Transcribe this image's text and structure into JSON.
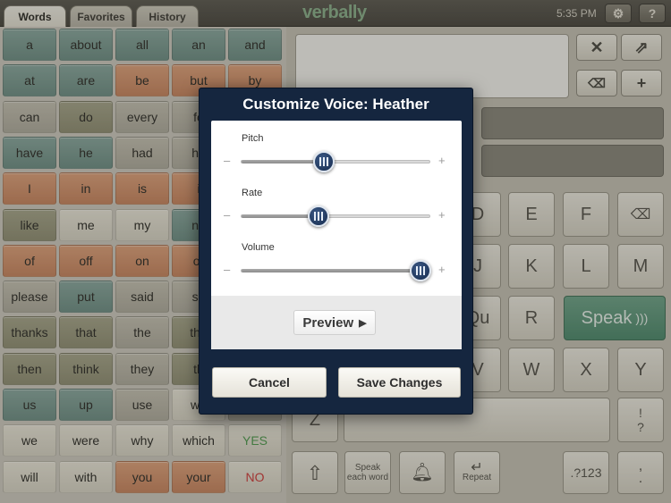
{
  "tabs": [
    {
      "label": "Words",
      "active": true
    },
    {
      "label": "Favorites",
      "active": false
    },
    {
      "label": "History",
      "active": false
    }
  ],
  "app_logo": "verbally",
  "clock": "5:35 PM",
  "topbar_buttons": {
    "settings_icon": "gear-icon",
    "help_label": "?"
  },
  "words": [
    {
      "label": "a",
      "color": "teal"
    },
    {
      "label": "about",
      "color": "teal"
    },
    {
      "label": "all",
      "color": "teal"
    },
    {
      "label": "an",
      "color": "teal"
    },
    {
      "label": "and",
      "color": "teal"
    },
    {
      "label": "at",
      "color": "teal"
    },
    {
      "label": "are",
      "color": "teal"
    },
    {
      "label": "be",
      "color": "orange"
    },
    {
      "label": "but",
      "color": "orange"
    },
    {
      "label": "by",
      "color": "orange"
    },
    {
      "label": "can",
      "color": "gray"
    },
    {
      "label": "do",
      "color": "olive"
    },
    {
      "label": "every",
      "color": "gray"
    },
    {
      "label": "fo",
      "color": "gray"
    },
    {
      "label": "",
      "color": "gray"
    },
    {
      "label": "have",
      "color": "teal"
    },
    {
      "label": "he",
      "color": "teal"
    },
    {
      "label": "had",
      "color": "gray"
    },
    {
      "label": "he",
      "color": "gray"
    },
    {
      "label": "",
      "color": "gray"
    },
    {
      "label": "I",
      "color": "orange"
    },
    {
      "label": "in",
      "color": "orange"
    },
    {
      "label": "is",
      "color": "orange"
    },
    {
      "label": "i",
      "color": "orange"
    },
    {
      "label": "",
      "color": "gray"
    },
    {
      "label": "like",
      "color": "olive"
    },
    {
      "label": "me",
      "color": "cream"
    },
    {
      "label": "my",
      "color": "cream"
    },
    {
      "label": "ne",
      "color": "teal"
    },
    {
      "label": "",
      "color": "gray"
    },
    {
      "label": "of",
      "color": "orange"
    },
    {
      "label": "off",
      "color": "orange"
    },
    {
      "label": "on",
      "color": "orange"
    },
    {
      "label": "or",
      "color": "orange"
    },
    {
      "label": "",
      "color": "gray"
    },
    {
      "label": "please",
      "color": "gray"
    },
    {
      "label": "put",
      "color": "teal"
    },
    {
      "label": "said",
      "color": "gray"
    },
    {
      "label": "sh",
      "color": "gray"
    },
    {
      "label": "",
      "color": "gray"
    },
    {
      "label": "thanks",
      "color": "olive"
    },
    {
      "label": "that",
      "color": "olive"
    },
    {
      "label": "the",
      "color": "gray"
    },
    {
      "label": "the",
      "color": "olive"
    },
    {
      "label": "",
      "color": "gray"
    },
    {
      "label": "then",
      "color": "olive"
    },
    {
      "label": "think",
      "color": "olive"
    },
    {
      "label": "they",
      "color": "gray"
    },
    {
      "label": "th",
      "color": "olive"
    },
    {
      "label": "",
      "color": "gray"
    },
    {
      "label": "us",
      "color": "teal"
    },
    {
      "label": "up",
      "color": "teal"
    },
    {
      "label": "use",
      "color": "gray"
    },
    {
      "label": "wa",
      "color": "cream"
    },
    {
      "label": "",
      "color": "gray"
    },
    {
      "label": "we",
      "color": "cream"
    },
    {
      "label": "were",
      "color": "cream"
    },
    {
      "label": "why",
      "color": "cream"
    },
    {
      "label": "which",
      "color": "cream"
    },
    {
      "label": "YES",
      "color": "yes"
    },
    {
      "label": "will",
      "color": "cream"
    },
    {
      "label": "with",
      "color": "cream"
    },
    {
      "label": "you",
      "color": "orange"
    },
    {
      "label": "your",
      "color": "orange"
    },
    {
      "label": "NO",
      "color": "no"
    }
  ],
  "side_buttons": {
    "clear_icon": "close-icon",
    "share_icon": "share-icon",
    "backspace_icon": "backspace-icon",
    "add_label": "+"
  },
  "keyboard": {
    "row1": [
      "D",
      "E",
      "F"
    ],
    "backspace_icon": "backspace-icon",
    "row2": [
      "J",
      "K",
      "L",
      "M"
    ],
    "row3": [
      "Qu",
      "R"
    ],
    "speak_label": "Speak",
    "row4": [
      "V",
      "W",
      "X",
      "Y"
    ],
    "z_key": "Z",
    "punct_top": "!\n?",
    "shift_icon": "shift-arrow-icon",
    "speak_each_word": "Speak each word",
    "bell_icon": "bell-icon",
    "repeat_label": "Repeat",
    "numbers_label": ".?123",
    "comma_period": ",\n."
  },
  "modal": {
    "title": "Customize Voice: Heather",
    "sliders": [
      {
        "label": "Pitch",
        "value": 0.44,
        "minus": "–",
        "plus": "+"
      },
      {
        "label": "Rate",
        "value": 0.41,
        "minus": "–",
        "plus": "+"
      },
      {
        "label": "Volume",
        "value": 0.95,
        "minus": "–",
        "plus": "+"
      }
    ],
    "preview_label": "Preview",
    "cancel_label": "Cancel",
    "save_label": "Save Changes"
  }
}
